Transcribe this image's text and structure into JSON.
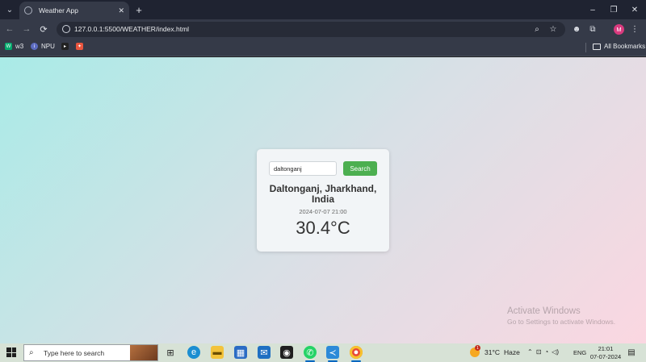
{
  "browser": {
    "tab_title": "Weather App",
    "tab_close": "✕",
    "new_tab": "+",
    "url": "127.0.0.1:5500/WEATHER/index.html",
    "profile_initial": "M",
    "window_controls": {
      "minimize": "–",
      "restore": "❐",
      "close": "✕"
    },
    "nav": {
      "back": "←",
      "forward": "→",
      "reload": "⟳"
    },
    "bookmarks": [
      {
        "label": "w3",
        "icon": "w3schools-icon",
        "color": "#04aa6d"
      },
      {
        "label": "NPU",
        "icon": "npu-icon",
        "color": "#5c6bc0"
      },
      {
        "label": "",
        "icon": "bookmark-icon-3",
        "color": "#222222"
      },
      {
        "label": "",
        "icon": "bookmark-icon-4",
        "color": "#e8553e"
      }
    ],
    "all_bookmarks": "All Bookmarks"
  },
  "weather": {
    "search_value": "daltonganj",
    "search_button": "Search",
    "city": "Daltonganj, Jharkhand, India",
    "datetime": "2024-07-07 21:00",
    "temperature": "30.4°C",
    "accent_color": "#4caf50"
  },
  "watermark": {
    "title": "Activate Windows",
    "subtitle": "Go to Settings to activate Windows."
  },
  "taskbar": {
    "search_placeholder": "Type here to search",
    "weather_temp": "31°C",
    "weather_desc": "Haze",
    "weather_badge": "1",
    "language": "ENG",
    "time": "21:01",
    "date": "07-07-2024",
    "apps": [
      "task-view-icon",
      "edge-icon",
      "file-explorer-icon",
      "store-icon",
      "mail-icon",
      "github-icon",
      "whatsapp-icon",
      "vscode-icon",
      "chrome-icon"
    ]
  }
}
